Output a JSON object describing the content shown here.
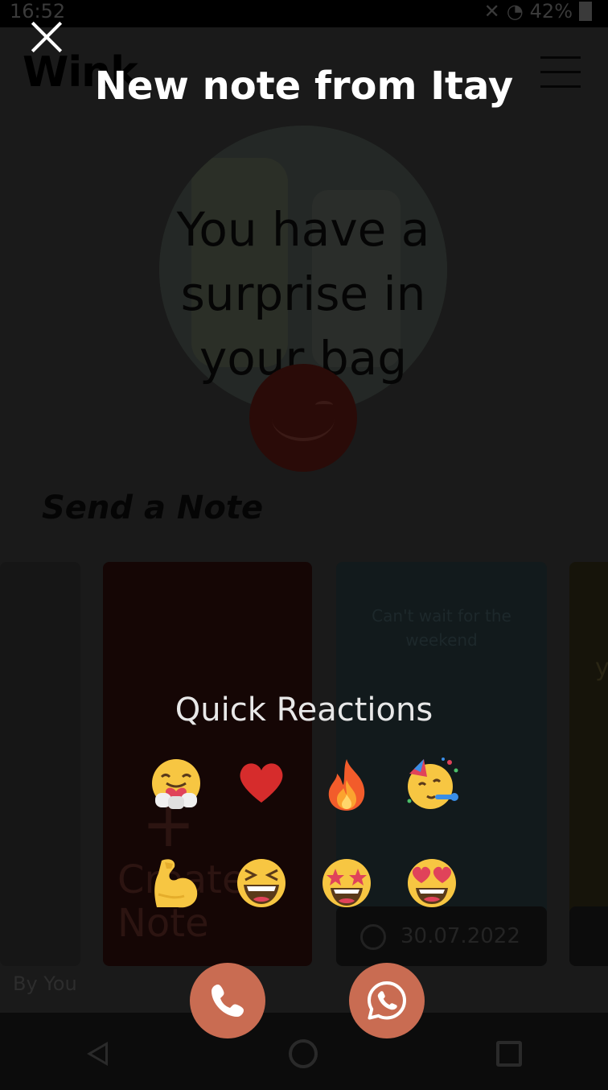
{
  "status_bar": {
    "time": "16:52",
    "battery": "42%"
  },
  "app": {
    "logo": "Wink",
    "hero_text": "You have a surprise in your bag",
    "section_title": "Send a Note",
    "create_card": {
      "plus": "+",
      "label": "Create a Note"
    },
    "note_card": {
      "text": "Can't wait for the weekend",
      "date": "30.07.2022"
    },
    "right_card_text": "y",
    "by_you": "By You"
  },
  "modal": {
    "title": "New note from Itay",
    "quick_reactions_title": "Quick Reactions",
    "reactions": [
      {
        "name": "hug-emoji",
        "label": "hugging face"
      },
      {
        "name": "heart-emoji",
        "label": "red heart"
      },
      {
        "name": "fire-emoji",
        "label": "fire"
      },
      {
        "name": "party-emoji",
        "label": "partying face"
      },
      {
        "name": "flexed-biceps-emoji",
        "label": "flexed biceps"
      },
      {
        "name": "laughing-emoji",
        "label": "grinning squinting face"
      },
      {
        "name": "star-struck-emoji",
        "label": "star-struck"
      },
      {
        "name": "heart-eyes-emoji",
        "label": "smiling face with heart-eyes"
      }
    ],
    "buttons": {
      "phone_icon": "phone-icon",
      "whatsapp_icon": "whatsapp-icon",
      "accent": "#c96c52"
    }
  }
}
